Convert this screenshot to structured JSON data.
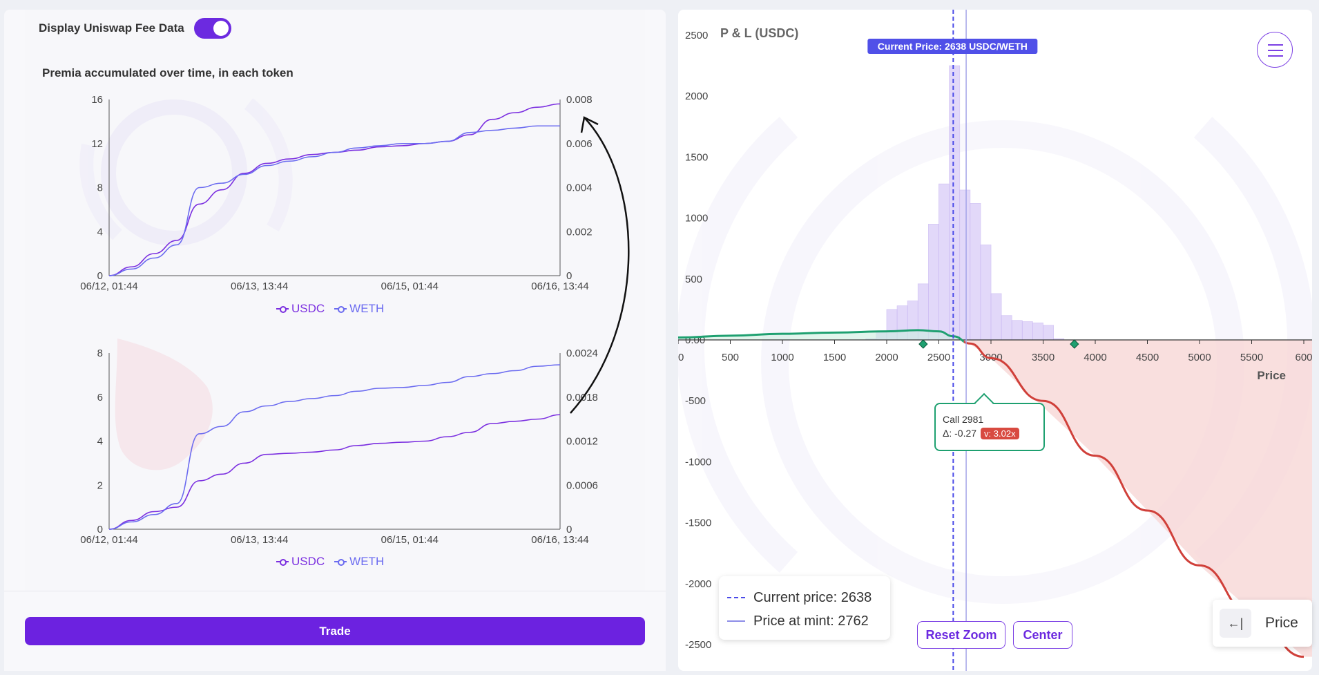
{
  "left": {
    "toggle_label": "Display Uniswap Fee Data",
    "section_title": "Premia accumulated over time, in each token",
    "legend": {
      "usdc": "USDC",
      "weth": "WETH"
    },
    "trade_label": "Trade"
  },
  "colors": {
    "usdc": "#7b2fe0",
    "weth": "#6b6bf0",
    "accent": "#6c22e0",
    "pnl_positive": "#1ea070",
    "pnl_negative": "#d0403a",
    "histogram": "#d9ccf7",
    "current_price_line": "#4a4ae8"
  },
  "chart_data": [
    {
      "type": "line",
      "x_tick_labels": [
        "06/12, 01:44",
        "06/13, 13:44",
        "06/15, 01:44",
        "06/16, 13:44"
      ],
      "y_left_ticks": [
        "0",
        "4",
        "8",
        "12",
        "16"
      ],
      "y_right_ticks": [
        "0",
        "0.002",
        "0.004",
        "0.006",
        "0.008"
      ],
      "ylim_left": [
        0,
        16
      ],
      "ylim_right": [
        0,
        0.008
      ],
      "x": [
        0,
        0.05,
        0.1,
        0.15,
        0.2,
        0.25,
        0.3,
        0.35,
        0.4,
        0.45,
        0.5,
        0.55,
        0.6,
        0.65,
        0.7,
        0.75,
        0.8,
        0.85,
        0.9,
        0.95,
        1.0
      ],
      "series": [
        {
          "name": "USDC",
          "axis": "left",
          "values": [
            0,
            0.8,
            2.0,
            3.2,
            6.5,
            7.8,
            9.3,
            10.2,
            10.6,
            11.0,
            11.2,
            11.4,
            11.7,
            11.8,
            12.0,
            12.2,
            12.8,
            14.2,
            14.8,
            15.3,
            15.6
          ]
        },
        {
          "name": "WETH",
          "axis": "right",
          "values": [
            0,
            0.0003,
            0.0008,
            0.0014,
            0.004,
            0.0042,
            0.0046,
            0.005,
            0.0052,
            0.0054,
            0.0056,
            0.0058,
            0.0059,
            0.006,
            0.006,
            0.0061,
            0.0065,
            0.0066,
            0.0067,
            0.0068,
            0.0068
          ]
        }
      ]
    },
    {
      "type": "line",
      "x_tick_labels": [
        "06/12, 01:44",
        "06/13, 13:44",
        "06/15, 01:44",
        "06/16, 13:44"
      ],
      "y_left_ticks": [
        "0",
        "2",
        "4",
        "6",
        "8"
      ],
      "y_right_ticks": [
        "0",
        "0.0006",
        "0.0012",
        "0.0018",
        "0.0024"
      ],
      "ylim_left": [
        0,
        8
      ],
      "ylim_right": [
        0,
        0.0024
      ],
      "x": [
        0,
        0.05,
        0.1,
        0.15,
        0.2,
        0.25,
        0.3,
        0.35,
        0.4,
        0.45,
        0.5,
        0.55,
        0.6,
        0.65,
        0.7,
        0.75,
        0.8,
        0.85,
        0.9,
        0.95,
        1.0
      ],
      "series": [
        {
          "name": "USDC",
          "axis": "left",
          "values": [
            0,
            0.4,
            0.8,
            1.0,
            2.2,
            2.5,
            3.0,
            3.4,
            3.45,
            3.5,
            3.6,
            3.8,
            3.9,
            3.95,
            4.0,
            4.2,
            4.4,
            4.8,
            4.9,
            5.0,
            5.2
          ]
        },
        {
          "name": "WETH",
          "axis": "right",
          "values": [
            0,
            0.0001,
            0.0002,
            0.00035,
            0.0013,
            0.0014,
            0.0016,
            0.00168,
            0.00174,
            0.00178,
            0.00182,
            0.00188,
            0.00192,
            0.00193,
            0.00196,
            0.002,
            0.00208,
            0.00212,
            0.00216,
            0.00222,
            0.00224
          ]
        }
      ]
    },
    {
      "type": "line",
      "title": "P & L (USDC)",
      "xlabel": "Price",
      "x_ticks": [
        "00",
        "500",
        "1000",
        "1500",
        "2000",
        "2500",
        "3000",
        "3500",
        "4000",
        "4500",
        "5000",
        "5500",
        "600"
      ],
      "y_ticks": [
        "2500",
        "2000",
        "1500",
        "1000",
        "500",
        "0.00",
        "-500",
        "-1000",
        "-1500",
        "-2000",
        "-2500"
      ],
      "xlim": [
        0,
        6000
      ],
      "ylim": [
        -2500,
        2500
      ],
      "current_price_badge": "Current Price: 2638 USDC/WETH",
      "current_price": 2638,
      "price_at_mint": 2762,
      "pnl_curve": {
        "x": [
          0,
          500,
          1000,
          1500,
          2000,
          2300,
          2500,
          2638,
          2800,
          3000,
          3500,
          4000,
          4500,
          5000,
          5500,
          6000
        ],
        "y": [
          20,
          35,
          50,
          60,
          70,
          80,
          70,
          30,
          -30,
          -150,
          -500,
          -950,
          -1400,
          -1850,
          -2250,
          -2600
        ]
      },
      "histogram": {
        "bin_start": 1800,
        "bin_width": 100,
        "heights": [
          10,
          60,
          250,
          280,
          320,
          460,
          950,
          1280,
          2250,
          1230,
          1120,
          780,
          380,
          200,
          160,
          150,
          140,
          120,
          10
        ]
      },
      "markers": [
        2350,
        3800
      ],
      "tooltip": {
        "title": "Call 2981",
        "delta": "Δ: -0.27",
        "v": "v: 3.02x"
      }
    }
  ],
  "right": {
    "legend": {
      "current": "Current price: 2638",
      "mint": "Price at mint: 2762"
    },
    "reset_zoom": "Reset Zoom",
    "center": "Center",
    "price_toggle": "Price",
    "price_arrow": "←|"
  }
}
